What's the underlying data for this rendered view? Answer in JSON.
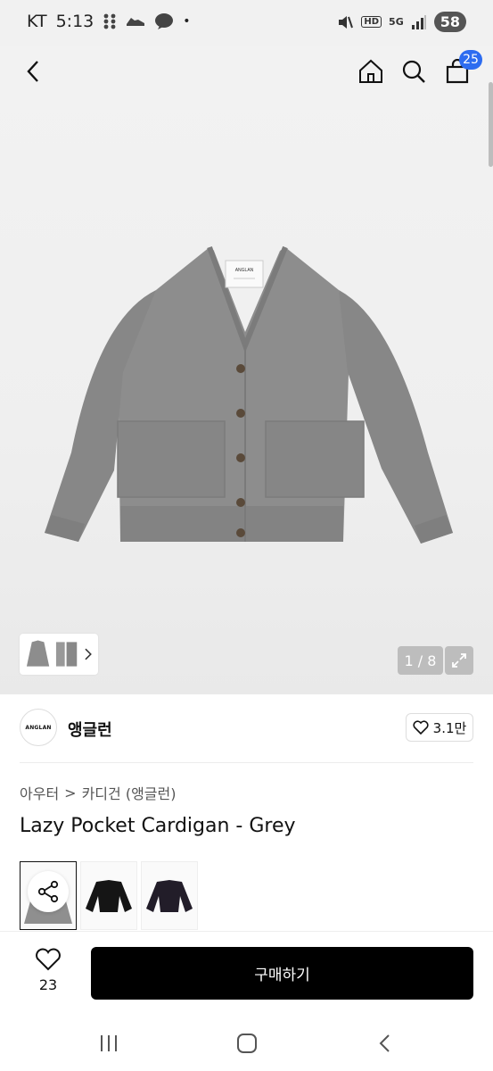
{
  "status_bar": {
    "carrier": "KT",
    "time": "5:13",
    "dot": "•",
    "talk_label": "TALK",
    "battery": "58",
    "network": "5G",
    "hd": "HD"
  },
  "header": {
    "cart_count": "25"
  },
  "gallery": {
    "label_text": "ANGLAN",
    "counter": "1 / 8"
  },
  "brand": {
    "logo_text": "ANGLAN",
    "name": "앵글런",
    "like_count": "3.1만"
  },
  "breadcrumb": {
    "level1": "아우터",
    "separator": ">",
    "level2": "카디건 (앵글런)"
  },
  "product": {
    "title": "Lazy Pocket Cardigan - Grey"
  },
  "color_options": [
    {
      "name": "grey",
      "color": "#8f8f8f"
    },
    {
      "name": "black",
      "color": "#151515"
    },
    {
      "name": "dark-purple",
      "color": "#221d29"
    }
  ],
  "bottom_bar": {
    "wish_count": "23",
    "buy_label": "구매하기"
  },
  "colors": {
    "accent": "#2d6cf0",
    "buy_button": "#000000",
    "overlay_chip": "#bdbdbd",
    "cardigan": "#8c8c8c"
  }
}
